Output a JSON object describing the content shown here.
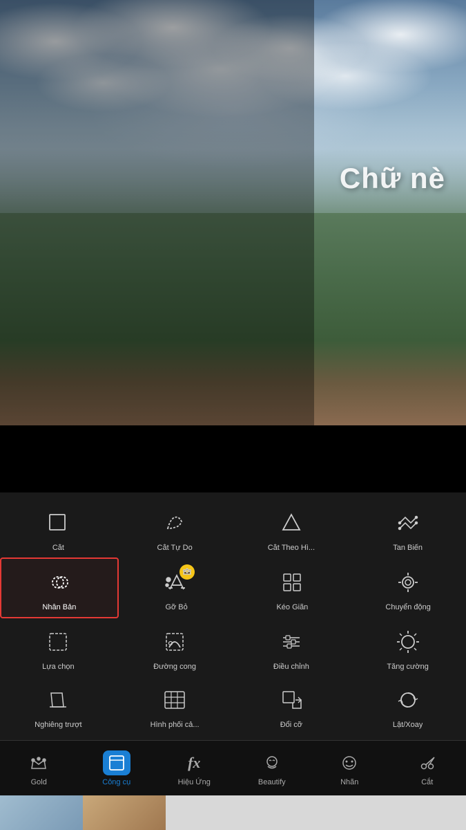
{
  "photo": {
    "overlay_text": "Chữ nè"
  },
  "tools": {
    "rows": [
      [
        {
          "id": "cat",
          "label": "Cắt",
          "icon": "crop"
        },
        {
          "id": "cat-tu-do",
          "label": "Cắt Tự Do",
          "icon": "freecut"
        },
        {
          "id": "cat-theo-hinh",
          "label": "Cắt Theo Hì...",
          "icon": "shapecrop"
        },
        {
          "id": "tan-bien",
          "label": "Tan Biến",
          "icon": "dissolve"
        }
      ],
      [
        {
          "id": "nhan-ban",
          "label": "Nhân Bản",
          "icon": "clone",
          "selected": true
        },
        {
          "id": "go-bo",
          "label": "Gỡ Bỏ",
          "icon": "remove",
          "badge": "crown"
        },
        {
          "id": "keo-gian",
          "label": "Kéo Giãn",
          "icon": "stretch"
        },
        {
          "id": "chuyen-dong",
          "label": "Chuyển động",
          "icon": "motion"
        }
      ],
      [
        {
          "id": "lua-chon",
          "label": "Lựa chọn",
          "icon": "select"
        },
        {
          "id": "duong-cong",
          "label": "Đường cong",
          "icon": "curve"
        },
        {
          "id": "dieu-chinh",
          "label": "Điều chỉnh",
          "icon": "adjust"
        },
        {
          "id": "tang-cuong",
          "label": "Tăng cường",
          "icon": "enhance"
        }
      ],
      [
        {
          "id": "nghieng-truot",
          "label": "Nghiêng trượt",
          "icon": "skew"
        },
        {
          "id": "hinh-phoi-ca",
          "label": "Hình phối cả...",
          "icon": "blend"
        },
        {
          "id": "doi-co",
          "label": "Đổi cỡ",
          "icon": "resize"
        },
        {
          "id": "lat-xoay",
          "label": "Lật/Xoay",
          "icon": "fliprotate"
        }
      ]
    ]
  },
  "bottom_nav": [
    {
      "id": "gold",
      "label": "Gold",
      "icon": "crown"
    },
    {
      "id": "cong-cu",
      "label": "Công cụ",
      "icon": "crop-nav",
      "active": true
    },
    {
      "id": "hieu-ung",
      "label": "Hiệu Ứng",
      "icon": "fx"
    },
    {
      "id": "beautify",
      "label": "Beautify",
      "icon": "face"
    },
    {
      "id": "nhan",
      "label": "Nhãn",
      "icon": "sticker"
    },
    {
      "id": "cat-nav",
      "label": "Cắt",
      "icon": "scissors"
    }
  ]
}
